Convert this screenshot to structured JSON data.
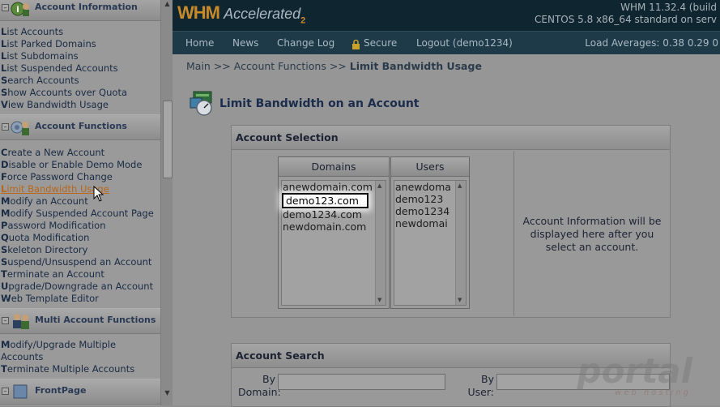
{
  "sidebar": {
    "sections": [
      {
        "title": "Account Information",
        "items": [
          "List Accounts",
          "List Parked Domains",
          "List Subdomains",
          "List Suspended Accounts",
          "Search Accounts",
          "Show Accounts over Quota",
          "View Bandwidth Usage"
        ]
      },
      {
        "title": "Account Functions",
        "items": [
          "Create a New Account",
          "Disable or Enable Demo Mode",
          "Force Password Change",
          "Limit Bandwidth Usage",
          "Modify an Account",
          "Modify Suspended Account Page",
          "Password Modification",
          "Quota Modification",
          "Skeleton Directory",
          "Suspend/Unsuspend an Account",
          "Terminate an Account",
          "Upgrade/Downgrade an Account",
          "Web Template Editor"
        ]
      },
      {
        "title": "Multi Account Functions",
        "items": [
          "Modify/Upgrade Multiple Accounts",
          "Terminate Multiple Accounts"
        ]
      },
      {
        "title": "FrontPage",
        "items": []
      }
    ]
  },
  "header": {
    "logo_main": "WHM",
    "logo_sub": "Accelerated",
    "logo_num": "2",
    "version": "WHM 11.32.4 (build",
    "server": "CENTOS 5.8 x86_64 standard on serv"
  },
  "nav": {
    "home": "Home",
    "news": "News",
    "changelog": "Change Log",
    "secure": "Secure",
    "logout": "Logout (demo1234)",
    "load": "Load Averages: 0.38 0.29 0"
  },
  "breadcrumb": {
    "path": "Main >> Account Functions >> ",
    "current": "Limit Bandwidth Usage"
  },
  "page": {
    "title": "Limit Bandwidth on an Account"
  },
  "account_selection": {
    "title": "Account Selection",
    "domains_header": "Domains",
    "users_header": "Users",
    "domains": [
      "anewdomain.com",
      "demo123.com",
      "demo1234.com",
      "newdomain.com"
    ],
    "users": [
      "anewdoma",
      "demo123",
      "demo1234",
      "newdomai"
    ],
    "info": "Account Information will be displayed here after you select an account."
  },
  "account_search": {
    "title": "Account Search",
    "by_domain_1": "By",
    "by_domain_2": "Domain:",
    "by_user_1": "By",
    "by_user_2": "User:"
  },
  "watermark": {
    "text": "portal",
    "sub": "web hosting"
  }
}
